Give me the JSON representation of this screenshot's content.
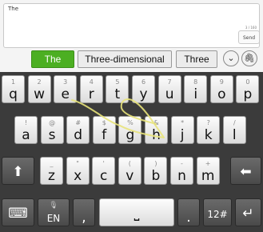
{
  "compose": {
    "text": "The",
    "counter": "3 / 160",
    "send_label": "Send"
  },
  "suggestions": [
    "The",
    "Three-dimensional",
    "Three"
  ],
  "keyboard": {
    "row1": [
      {
        "hint": "1",
        "label": "q"
      },
      {
        "hint": "2",
        "label": "w"
      },
      {
        "hint": "3",
        "label": "e"
      },
      {
        "hint": "4",
        "label": "r"
      },
      {
        "hint": "5",
        "label": "t"
      },
      {
        "hint": "6",
        "label": "y"
      },
      {
        "hint": "7",
        "label": "u"
      },
      {
        "hint": "8",
        "label": "i"
      },
      {
        "hint": "9",
        "label": "o"
      },
      {
        "hint": "0",
        "label": "p"
      }
    ],
    "row2": [
      {
        "hint": "!",
        "label": "a"
      },
      {
        "hint": "@",
        "label": "s"
      },
      {
        "hint": "#",
        "label": "d"
      },
      {
        "hint": "$",
        "label": "f"
      },
      {
        "hint": "%",
        "label": "g"
      },
      {
        "hint": "&",
        "label": "h"
      },
      {
        "hint": "*",
        "label": "j"
      },
      {
        "hint": "?",
        "label": "k"
      },
      {
        "hint": "/",
        "label": "l"
      }
    ],
    "row3": [
      {
        "hint": "_",
        "label": "z"
      },
      {
        "hint": "\"",
        "label": "x"
      },
      {
        "hint": "'",
        "label": "c"
      },
      {
        "hint": "(",
        "label": "v"
      },
      {
        "hint": ")",
        "label": "b"
      },
      {
        "hint": "-",
        "label": "n"
      },
      {
        "hint": "+",
        "label": "m"
      }
    ],
    "lang_label": "EN",
    "comma_label": ",",
    "period_label": ".",
    "symbols_label": "12#",
    "shift_icon": "shift-arrow-icon",
    "backspace_icon": "backspace-icon",
    "enter_icon": "enter-icon",
    "keyboard_icon": "keyboard-icon",
    "mic_icon": "microphone-icon",
    "space_icon": "space-bar-icon"
  }
}
